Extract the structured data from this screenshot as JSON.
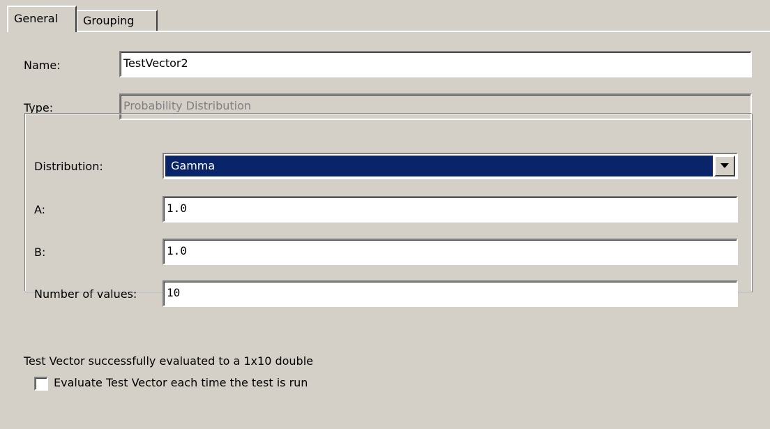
{
  "tabs": [
    {
      "label": "General"
    },
    {
      "label": "Grouping"
    }
  ],
  "form": {
    "name_label": "Name:",
    "name_value": "TestVector2",
    "type_label": "Type:",
    "type_value": "Probability Distribution"
  },
  "distribution": {
    "label": "Distribution:",
    "selected": "Gamma",
    "a_label": "A:",
    "a_value": "1.0",
    "b_label": "B:",
    "b_value": "1.0",
    "count_label": "Number of values:",
    "count_value": "10"
  },
  "status": {
    "message": "Test Vector successfully evaluated to a 1x10 double"
  },
  "options": {
    "evaluate_label": "Evaluate Test Vector each time the test is run",
    "evaluate_checked": false
  },
  "colors": {
    "background": "#d4d0c8",
    "selection": "#0a246a",
    "disabled_text": "#808080"
  }
}
